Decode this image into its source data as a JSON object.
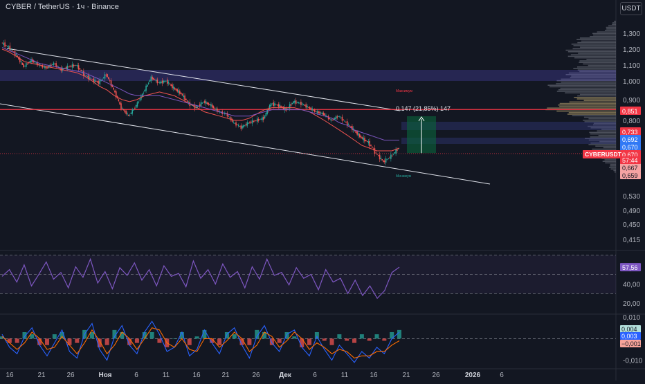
{
  "header": {
    "title": "CYBER / TetherUS · 1ч · Binance",
    "currency": "USDT"
  },
  "colors": {
    "background": "#131722",
    "up": "#26a69a",
    "down": "#ef5350",
    "rsi": "#7e57c2",
    "macd": "#2962ff",
    "signal": "#ff6d00",
    "volume_profile": "#6b7280",
    "channel": "#e0e3eb",
    "resistance": "#f23645"
  },
  "chart_data": [
    {
      "type": "line",
      "panel": "price",
      "y_scale": "log",
      "ylim": [
        0.36,
        1.46
      ],
      "y_ticks": [
        "1,300",
        "1,200",
        "1,100",
        "1,000",
        "0,900",
        "0,800",
        "0,530",
        "0,490",
        "0,450",
        "0,415"
      ],
      "y_tick_values": [
        1.3,
        1.2,
        1.1,
        1.0,
        0.9,
        0.8,
        0.53,
        0.49,
        0.45,
        0.415
      ],
      "x_ticks": [
        "16",
        "21",
        "26",
        "Ноя",
        "6",
        "11",
        "16",
        "21",
        "26",
        "Дек",
        "6",
        "11",
        "16",
        "21",
        "26",
        "2026",
        "6"
      ],
      "bold_x_ticks": [
        "Ноя",
        "Дек",
        "2026"
      ],
      "series": [
        {
          "values": [
            1.24,
            1.21,
            1.16,
            1.09,
            1.13,
            1.1,
            1.08,
            1.11,
            1.07,
            1.09,
            1.1,
            1.04,
            1.01,
            0.99,
            1.04,
            0.95,
            0.86,
            0.82,
            0.87,
            0.94,
            1.02,
            0.99,
            1.0,
            0.96,
            0.93,
            0.88,
            0.86,
            0.89,
            0.87,
            0.84,
            0.83,
            0.79,
            0.77,
            0.79,
            0.8,
            0.81,
            0.88,
            0.87,
            0.85,
            0.89,
            0.88,
            0.86,
            0.84,
            0.83,
            0.8,
            0.82,
            0.79,
            0.76,
            0.73,
            0.71,
            0.67,
            0.64,
            0.66,
            0.69
          ]
        },
        {
          "values": [
            1.2,
            1.18,
            1.15,
            1.12,
            1.11,
            1.1,
            1.09,
            1.08,
            1.07,
            1.06,
            1.05,
            1.03,
            1.0,
            0.97,
            0.95,
            0.92,
            0.9,
            0.89,
            0.9,
            0.92,
            0.93,
            0.94,
            0.93,
            0.92,
            0.9,
            0.88,
            0.86,
            0.84,
            0.83,
            0.82,
            0.81,
            0.8,
            0.8,
            0.81,
            0.83,
            0.85,
            0.86,
            0.86,
            0.86,
            0.86,
            0.85,
            0.84,
            0.82,
            0.8,
            0.78,
            0.76,
            0.74,
            0.72,
            0.7,
            0.69,
            0.68,
            0.68,
            0.68,
            0.69
          ]
        },
        {
          "values": [
            1.21,
            1.19,
            1.17,
            1.15,
            1.13,
            1.11,
            1.1,
            1.09,
            1.08,
            1.07,
            1.06,
            1.05,
            1.03,
            1.01,
            0.99,
            0.97,
            0.95,
            0.93,
            0.92,
            0.92,
            0.92,
            0.92,
            0.91,
            0.9,
            0.89,
            0.88,
            0.87,
            0.86,
            0.85,
            0.84,
            0.83,
            0.82,
            0.82,
            0.82,
            0.83,
            0.84,
            0.85,
            0.85,
            0.85,
            0.85,
            0.85,
            0.84,
            0.83,
            0.82,
            0.81,
            0.79,
            0.78,
            0.76,
            0.75,
            0.74,
            0.73,
            0.72,
            0.72,
            0.72
          ]
        }
      ],
      "markers": [
        {
          "label": "0,851",
          "value": 0.851,
          "color": "#f23645"
        },
        {
          "label": "0,733",
          "value": 0.733,
          "color": "#f23645"
        },
        {
          "label": "0,692",
          "value": 0.692,
          "color": "#3179f5"
        },
        {
          "label": "0,670",
          "value": 0.67,
          "color": "#3179f5"
        },
        {
          "label": "0,670",
          "value": 0.67,
          "color": "#f23645"
        },
        {
          "label": "0,667",
          "value": 0.667,
          "color": "#f5a3a3"
        },
        {
          "label": "0,659",
          "value": 0.659,
          "color": "#f5a3a3"
        }
      ],
      "symbol_tag": {
        "label": "CYBERUSDT",
        "countdown": "57:44",
        "color": "#f23645"
      },
      "measurement": {
        "label": "0.147 (21,85%) 147",
        "from": 0.672,
        "to": 0.819
      },
      "annotations": [
        {
          "label": "Максимум"
        },
        {
          "label": "Минимум"
        }
      ],
      "resistance_level": 0.851
    },
    {
      "type": "line",
      "panel": "rsi",
      "ylim": [
        10,
        75
      ],
      "y_ticks": [
        "40,00",
        "20,00"
      ],
      "y_tick_values": [
        40,
        20
      ],
      "band": [
        30,
        70
      ],
      "last_label": "57,56",
      "series": [
        {
          "name": "RSI",
          "values": [
            48,
            55,
            42,
            60,
            38,
            50,
            63,
            45,
            52,
            36,
            58,
            47,
            66,
            41,
            53,
            35,
            57,
            49,
            62,
            44,
            55,
            38,
            59,
            48,
            51,
            37,
            64,
            46,
            55,
            40,
            61,
            47,
            53,
            36,
            58,
            45,
            66,
            49,
            52,
            39,
            57,
            46,
            50,
            34,
            55,
            42,
            46,
            30,
            44,
            28,
            38,
            25,
            33,
            52,
            57.56
          ]
        }
      ]
    },
    {
      "type": "bar",
      "panel": "macd",
      "ylim": [
        -0.013,
        0.011
      ],
      "y_ticks": [
        "0,010",
        "0,000",
        "-0,010"
      ],
      "y_tick_values": [
        0.01,
        0.0,
        -0.01
      ],
      "last_labels": [
        {
          "label": "0,004",
          "color": "#b2dfdb",
          "text_color": "#131722"
        },
        {
          "label": "0,003",
          "color": "#2962ff",
          "text_color": "#ffffff"
        },
        {
          "label": "−0,001",
          "color": "#f7a399",
          "text_color": "#131722"
        }
      ],
      "series": [
        {
          "name": "MACD",
          "values": [
            0.002,
            -0.004,
            -0.007,
            0.001,
            0.005,
            -0.003,
            -0.008,
            -0.002,
            0.004,
            -0.006,
            -0.009,
            0.002,
            0.007,
            -0.005,
            -0.01,
            0.001,
            0.006,
            -0.003,
            -0.007,
            0.003,
            0.008,
            0.002,
            -0.006,
            -0.004,
            0.003,
            -0.008,
            -0.005,
            0.004,
            -0.002,
            -0.007,
            0.002,
            0.005,
            -0.003,
            -0.009,
            0.001,
            0.006,
            -0.002,
            -0.006,
            0.002,
            0.004,
            -0.004,
            -0.008,
            0.001,
            -0.005,
            -0.01,
            -0.003,
            -0.007,
            -0.011,
            -0.006,
            -0.009,
            -0.004,
            -0.007,
            0.0,
            0.003
          ]
        },
        {
          "name": "Signal",
          "values": [
            0.001,
            -0.002,
            -0.005,
            -0.002,
            0.003,
            0.0,
            -0.005,
            -0.004,
            0.001,
            -0.003,
            -0.007,
            -0.002,
            0.004,
            -0.001,
            -0.007,
            -0.003,
            0.003,
            0.0,
            -0.005,
            0.0,
            0.005,
            0.004,
            -0.002,
            -0.004,
            0.0,
            -0.005,
            -0.006,
            0.0,
            0.0,
            -0.004,
            -0.001,
            0.003,
            0.0,
            -0.006,
            -0.003,
            0.003,
            0.001,
            -0.004,
            -0.001,
            0.003,
            0.0,
            -0.005,
            -0.002,
            -0.004,
            -0.007,
            -0.005,
            -0.006,
            -0.009,
            -0.008,
            -0.008,
            -0.006,
            -0.006,
            -0.003,
            -0.001
          ]
        },
        {
          "name": "Histogram",
          "values": [
            0.001,
            -0.002,
            -0.002,
            0.003,
            0.002,
            -0.003,
            -0.003,
            0.002,
            0.003,
            -0.003,
            -0.002,
            0.004,
            0.003,
            -0.004,
            -0.003,
            0.004,
            0.003,
            -0.003,
            -0.002,
            0.003,
            0.003,
            -0.002,
            -0.004,
            0.0,
            0.003,
            -0.003,
            0.001,
            0.004,
            -0.002,
            -0.003,
            0.003,
            0.002,
            -0.003,
            -0.003,
            0.004,
            0.003,
            -0.003,
            -0.002,
            0.003,
            0.001,
            -0.004,
            -0.003,
            0.003,
            -0.001,
            -0.003,
            0.002,
            -0.001,
            -0.002,
            0.002,
            -0.001,
            0.002,
            -0.001,
            0.003,
            0.004
          ]
        }
      ]
    }
  ]
}
